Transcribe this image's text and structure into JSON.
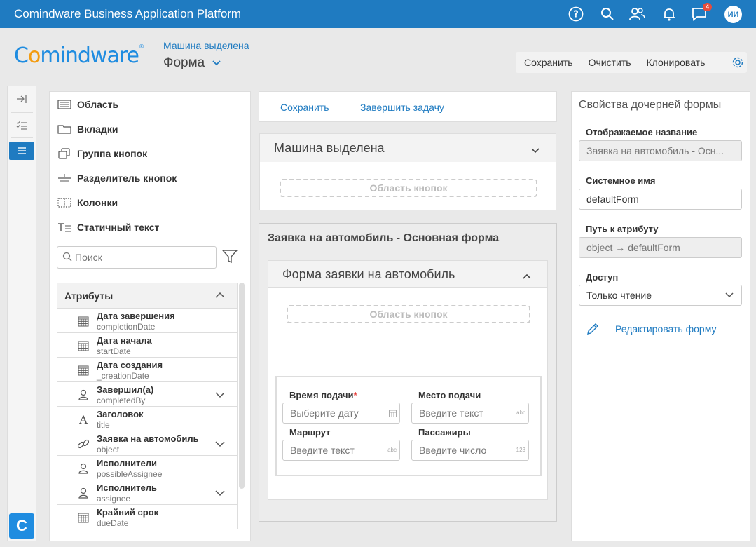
{
  "app": {
    "title": "Comindware Business Application Platform",
    "notifications_count": "4",
    "user_initials": "ИИ"
  },
  "logo": {
    "pre": "C",
    "o": "o",
    "post": "mindware"
  },
  "header": {
    "breadcrumb": "Машина выделена",
    "form_selector": "Форма"
  },
  "toolbar": {
    "save": "Сохранить",
    "clear": "Очистить",
    "clone": "Клонировать"
  },
  "tools": [
    {
      "label": "Область",
      "icon": "area-icon"
    },
    {
      "label": "Вкладки",
      "icon": "tabs-icon"
    },
    {
      "label": "Группа кнопок",
      "icon": "button-group-icon"
    },
    {
      "label": "Разделитель кнопок",
      "icon": "button-separator-icon"
    },
    {
      "label": "Колонки",
      "icon": "columns-icon"
    },
    {
      "label": "Статичный текст",
      "icon": "static-text-icon"
    }
  ],
  "search": {
    "placeholder": "Поиск"
  },
  "attributes": {
    "header": "Атрибуты",
    "items": [
      {
        "name": "Дата завершения",
        "sys": "completionDate",
        "icon": "calendar-icon"
      },
      {
        "name": "Дата начала",
        "sys": "startDate",
        "icon": "calendar-icon"
      },
      {
        "name": "Дата создания",
        "sys": "_creationDate",
        "icon": "calendar-icon"
      },
      {
        "name": "Завершил(а)",
        "sys": "completedBy",
        "icon": "user-icon"
      },
      {
        "name": "Заголовок",
        "sys": "title",
        "icon": "text-icon"
      },
      {
        "name": "Заявка на автомобиль",
        "sys": "object",
        "icon": "link-icon"
      },
      {
        "name": "Исполнители",
        "sys": "possibleAssignee",
        "icon": "user-icon"
      },
      {
        "name": "Исполнитель",
        "sys": "assignee",
        "icon": "user-icon"
      },
      {
        "name": "Крайний срок",
        "sys": "dueDate",
        "icon": "calendar-icon"
      }
    ]
  },
  "canvas": {
    "top_actions": {
      "save": "Сохранить",
      "complete": "Завершить задачу"
    },
    "card1": {
      "title": "Машина выделена",
      "button_area": "Область кнопок"
    },
    "outer_title": "Заявка на автомобиль - Основная форма",
    "card2": {
      "title": "Форма заявки на автомобиль",
      "button_area": "Область кнопок"
    },
    "fields": {
      "time_label": "Время подачи",
      "time_required": "*",
      "time_placeholder": "Выберите дату",
      "place_label": "Место подачи",
      "place_placeholder": "Введите текст",
      "place_hint": "abc",
      "route_label": "Маршрут",
      "route_placeholder": "Введите текст",
      "route_hint": "abc",
      "pass_label": "Пассажиры",
      "pass_placeholder": "Введите число",
      "pass_hint": "123"
    }
  },
  "props": {
    "title": "Свойства дочерней формы",
    "display_name_label": "Отображаемое название",
    "display_name_value": "Заявка на автомобиль - Осн...",
    "system_name_label": "Системное имя",
    "system_name_value": "defaultForm",
    "path_label": "Путь к атрибуту",
    "path_value": "object → defaultForm",
    "access_label": "Доступ",
    "access_value": "Только чтение",
    "edit_form": "Редактировать форму"
  }
}
